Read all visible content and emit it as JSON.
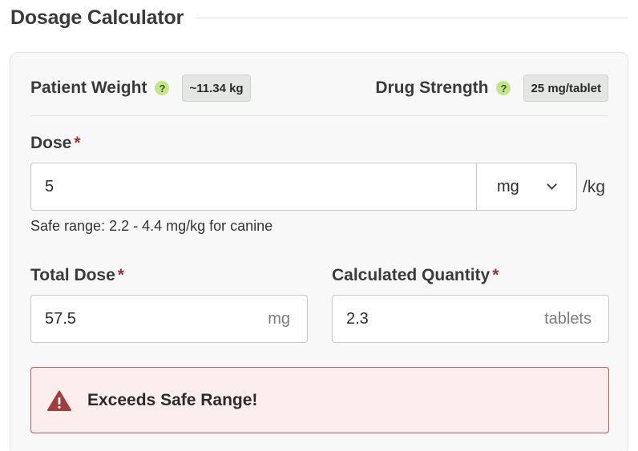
{
  "header": {
    "title": "Dosage Calculator"
  },
  "info": {
    "weight_label": "Patient Weight",
    "weight_value": "~11.34 kg",
    "strength_label": "Drug Strength",
    "strength_value": "25 mg/tablet",
    "help_glyph": "?"
  },
  "dose": {
    "label": "Dose",
    "required_mark": "*",
    "value": "5",
    "unit": "mg",
    "per": "/kg",
    "hint": "Safe range: 2.2 - 4.4 mg/kg for canine"
  },
  "total": {
    "label": "Total Dose",
    "required_mark": "*",
    "value": "57.5",
    "suffix": "mg"
  },
  "quantity": {
    "label": "Calculated Quantity",
    "required_mark": "*",
    "value": "2.3",
    "suffix": "tablets"
  },
  "alert": {
    "text": "Exceeds Safe Range!",
    "icon": "warning-triangle-icon",
    "color": "#a43c3c"
  },
  "colors": {
    "help_bg": "#c6e48a",
    "required": "#a53030",
    "alert_bg": "#fdeeee",
    "alert_border": "#b55e5e"
  }
}
